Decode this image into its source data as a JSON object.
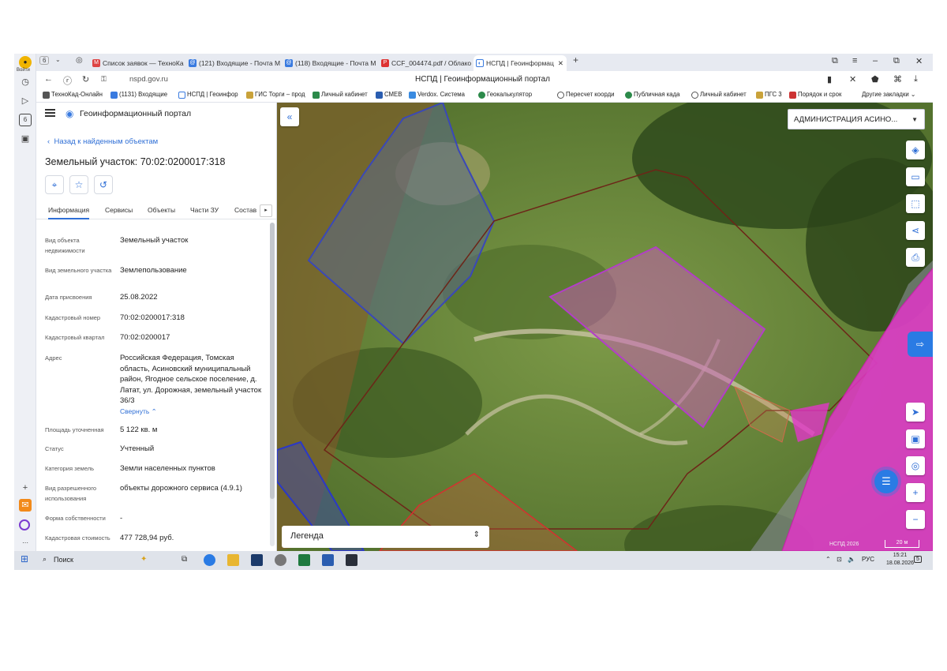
{
  "browser": {
    "tab_count": "6",
    "tabs": [
      {
        "label": "Список заявок — ТехноКа",
        "icon": "gmail-icon"
      },
      {
        "label": "(121) Входящие - Почта М",
        "icon": "mail-icon"
      },
      {
        "label": "(118) Входящие - Почта М",
        "icon": "mail-icon"
      },
      {
        "label": "CCF_004474.pdf / Облако",
        "icon": "pdf-icon"
      },
      {
        "label": "НСПД | Геоинформац",
        "icon": "nspd-icon",
        "active": true
      }
    ],
    "address": "nspd.gov.ru",
    "page_title": "НСПД | Геоинформационный портал",
    "bookmarks": [
      "ТехноКад-Онлайн",
      "(1131) Входящие",
      "НСПД | Геоинфор",
      "ГИС Торги – прод",
      "Личный кабинет",
      "СМЕВ",
      "Verdox. Система",
      "Геокалькулятор",
      "Пересчет коорди",
      "Публичная када",
      "Личный кабинет",
      "ПГС 3",
      "Порядок и срок"
    ],
    "other_bookmarks": "Другие закладки",
    "profile_label": "Войти"
  },
  "panel": {
    "app_title": "Геоинформационный портал",
    "back_link": "Назад к найденным объектам",
    "object_title": "Земельный участок: 70:02:0200017:318",
    "tabs": [
      "Информация",
      "Сервисы",
      "Объекты",
      "Части ЗУ",
      "Состав"
    ],
    "fields": [
      {
        "label": "Вид объекта недвижимости",
        "value": "Земельный участок"
      },
      {
        "label": "Вид земельного участка",
        "value": "Землепользование"
      },
      {
        "label": "Дата присвоения",
        "value": "25.08.2022"
      },
      {
        "label": "Кадастровый номер",
        "value": "70:02:0200017:318"
      },
      {
        "label": "Кадастровый квартал",
        "value": "70:02:0200017"
      },
      {
        "label": "Адрес",
        "value": "Российская Федерация, Томская область, Асиновский муниципальный район, Ягодное сельское поселение, д. Латат, ул. Дорожная, земельный участок 36/3"
      },
      {
        "label": "Площадь уточненная",
        "value": "5 122 кв. м"
      },
      {
        "label": "Статус",
        "value": "Учтенный"
      },
      {
        "label": "Категория земель",
        "value": "Земли населенных пунктов"
      },
      {
        "label": "Вид разрешенного использования",
        "value": "объекты дорожного сервиса (4.9.1)"
      },
      {
        "label": "Форма собственности",
        "value": "-"
      },
      {
        "label": "Кадастровая стоимость",
        "value": "477 728,94 руб."
      }
    ],
    "collapse_label": "Свернуть"
  },
  "map": {
    "admin_select": "АДМИНИСТРАЦИЯ АСИНО...",
    "legend": "Легенда",
    "copyright": "НСПД 2026",
    "scale": "20 м"
  },
  "taskbar": {
    "search": "Поиск",
    "lang": "РУС",
    "time": "15:21",
    "date": "18.08.2026",
    "notifications": "5"
  },
  "colors": {
    "accent": "#2f6fd6",
    "parcel_selected": "#c03cc8",
    "road_zone": "#e236c8",
    "boundary": "#7a2a1a"
  }
}
